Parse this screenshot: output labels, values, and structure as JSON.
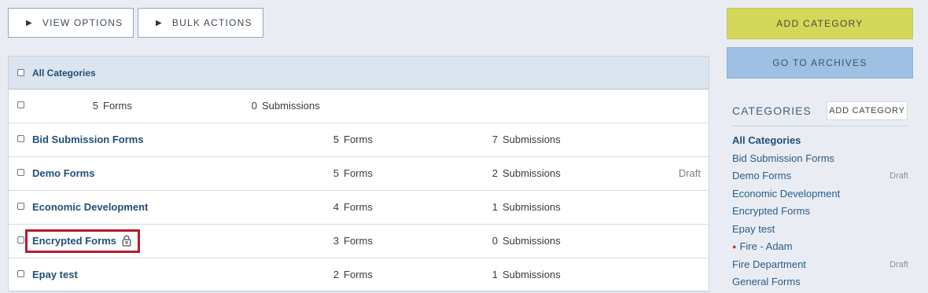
{
  "toolbar": {
    "view_options": "VIEW OPTIONS",
    "bulk_actions": "BULK ACTIONS"
  },
  "table": {
    "header_label": "All Categories",
    "rows": [
      {
        "name": "",
        "forms_count": "5",
        "forms_label": "Forms",
        "submissions_count": "0",
        "submissions_label": "Submissions",
        "status": ""
      },
      {
        "name": "Bid Submission Forms",
        "forms_count": "5",
        "forms_label": "Forms",
        "submissions_count": "7",
        "submissions_label": "Submissions",
        "status": ""
      },
      {
        "name": "Demo Forms",
        "forms_count": "5",
        "forms_label": "Forms",
        "submissions_count": "2",
        "submissions_label": "Submissions",
        "status": "Draft"
      },
      {
        "name": "Economic Development",
        "forms_count": "4",
        "forms_label": "Forms",
        "submissions_count": "1",
        "submissions_label": "Submissions",
        "status": ""
      },
      {
        "name": "Encrypted Forms",
        "forms_count": "3",
        "forms_label": "Forms",
        "submissions_count": "0",
        "submissions_label": "Submissions",
        "status": "",
        "icon": "lock-icon"
      },
      {
        "name": "Epay test",
        "forms_count": "2",
        "forms_label": "Forms",
        "submissions_count": "1",
        "submissions_label": "Submissions",
        "status": ""
      }
    ]
  },
  "sidebar": {
    "add_category": "ADD CATEGORY",
    "go_to_archives": "GO TO ARCHIVES",
    "categories_title": "CATEGORIES",
    "add_category_small": "ADD CATEGORY",
    "items": [
      {
        "label": "All Categories",
        "status": ""
      },
      {
        "label": "Bid Submission Forms",
        "status": ""
      },
      {
        "label": "Demo Forms",
        "status": "Draft"
      },
      {
        "label": "Economic Development",
        "status": ""
      },
      {
        "label": "Encrypted Forms",
        "status": ""
      },
      {
        "label": "Epay test",
        "status": ""
      },
      {
        "label": "Fire - Adam",
        "status": ""
      },
      {
        "label": "Fire Department",
        "status": "Draft"
      },
      {
        "label": "General Forms",
        "status": ""
      }
    ]
  },
  "colors": {
    "add_button": "#d4d85a",
    "archives_button": "#9ec0e2",
    "highlight": "#b7192b"
  }
}
